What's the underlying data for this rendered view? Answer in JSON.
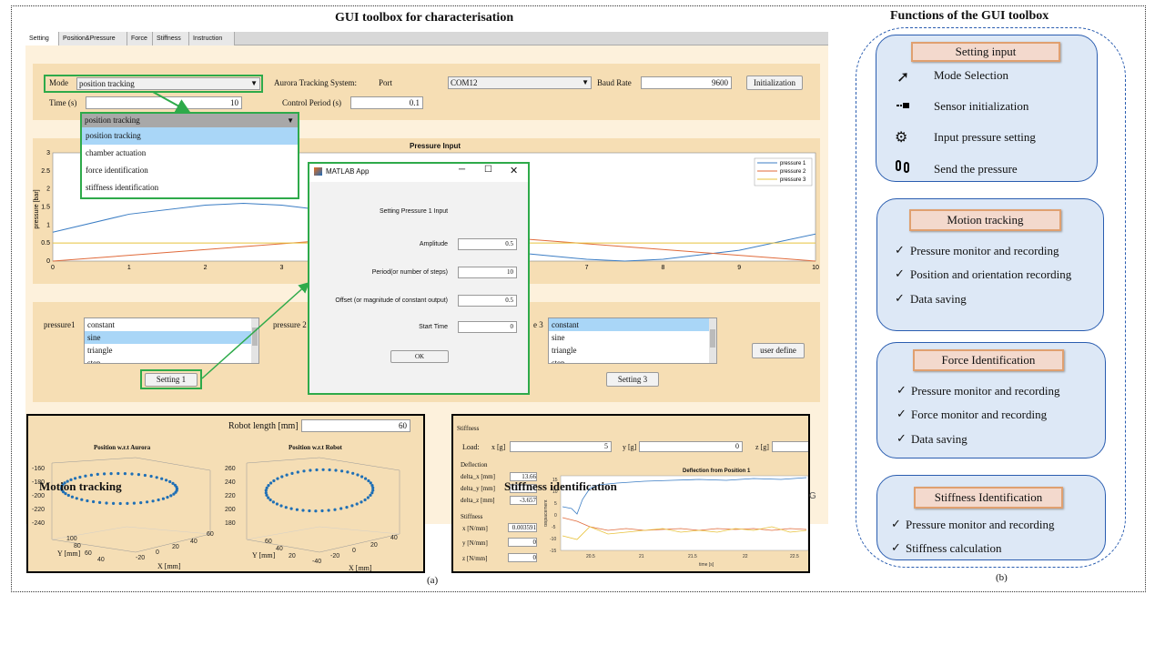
{
  "figure": {
    "left_title": "GUI toolbox for characterisation",
    "right_title": "Functions  of the GUI toolbox",
    "label_a": "(a)",
    "label_b": "(b)"
  },
  "tabs": [
    "Setting",
    "Position&Pressure",
    "Force",
    "Stiffness",
    "Instruction"
  ],
  "setting": {
    "mode_label": "Mode",
    "mode_value": "position tracking",
    "aurora_label": "Aurora Tracking System:",
    "port_label": "Port",
    "port_value": "COM12",
    "baud_label": "Baud Rate",
    "baud_value": "9600",
    "init_button": "Initialization",
    "time_label": "Time (s)",
    "time_value": "10",
    "control_label": "Control Period (s)",
    "control_value": "0.1"
  },
  "mode_dropdown": {
    "header": "position tracking",
    "options": [
      "position tracking",
      "chamber actuation",
      "force identification",
      "stiffness identification"
    ]
  },
  "pressure_chart": {
    "title": "Pressure Input",
    "ylabel": "pressure [bar]",
    "yticks": [
      "3",
      "2.5",
      "2",
      "1.5",
      "1",
      "0.5",
      "0"
    ],
    "xticks": [
      "0",
      "1",
      "2",
      "3",
      "7",
      "8",
      "9",
      "10"
    ],
    "legend": [
      "pressure 1",
      "pressure 2",
      "pressure 3"
    ],
    "colors": [
      "#3b7dc4",
      "#e06a3a",
      "#e8c23b"
    ]
  },
  "chart_data": {
    "type": "line",
    "title": "Pressure Input",
    "xlabel": "",
    "ylabel": "pressure [bar]",
    "xlim": [
      0,
      10
    ],
    "ylim": [
      0,
      3
    ],
    "series": [
      {
        "name": "pressure 1",
        "x": [
          0,
          1,
          2,
          2.5,
          3,
          4,
          5,
          6,
          7,
          7.5,
          8,
          9,
          10
        ],
        "values": [
          0.8,
          1.3,
          1.55,
          1.6,
          1.55,
          1.3,
          0.8,
          0.25,
          0.05,
          0.0,
          0.05,
          0.3,
          0.75
        ]
      },
      {
        "name": "pressure 2",
        "x": [
          0,
          5,
          10
        ],
        "values": [
          0,
          0.8,
          0
        ]
      },
      {
        "name": "pressure 3",
        "x": [
          0,
          10
        ],
        "values": [
          0.5,
          0.5
        ]
      }
    ]
  },
  "pressure_select": {
    "p1_label": "pressure1",
    "p2_label": "pressure 2",
    "p3_label": "e 3",
    "list1": [
      "constant",
      "sine",
      "triangle",
      "step"
    ],
    "list3": [
      "constant",
      "sine",
      "triangle",
      "step"
    ],
    "setting1_button": "Setting 1",
    "setting3_button": "Setting 3",
    "user_define_button": "user define"
  },
  "dialog": {
    "title": "MATLAB App",
    "heading": "Setting Pressure 1 Input",
    "amplitude_label": "Amplitude",
    "amplitude_value": "0.5",
    "period_label": "Period(or number of steps)",
    "period_value": "10",
    "offset_label": "Offset (or magnitude of constant output)",
    "offset_value": "0.5",
    "start_label": "Start Time",
    "start_value": "0",
    "ok_button": "OK"
  },
  "motion": {
    "robot_length_label": "Robot length [mm]",
    "robot_length_value": "60",
    "plot1_title": "Position w.r.t Aurora",
    "plot2_title": "Position w.r.t Robot",
    "overlay_label": "Motion tracking",
    "plot1_z_ticks": [
      "-160",
      "-180",
      "-200",
      "-220",
      "-240"
    ],
    "plot1_y_ticks": [
      "100",
      "80",
      "60",
      "40"
    ],
    "plot1_x_ticks": [
      "-20",
      "0",
      "20",
      "40",
      "60"
    ],
    "plot2_z_ticks": [
      "260",
      "240",
      "220",
      "200",
      "180"
    ],
    "plot2_y_ticks": [
      "60",
      "40",
      "20"
    ],
    "plot2_x_ticks": [
      "-40",
      "-20",
      "0",
      "20",
      "40"
    ],
    "y_axis_label": "Y [mm]",
    "x_axis_label": "X [mm]"
  },
  "stiffness": {
    "panel_label": "Stiffness",
    "load_label": "Load:",
    "x_label": "x [g]",
    "x_value": "5",
    "y_label": "y [g]",
    "y_value": "0",
    "z_label": "z [g]",
    "deflection_label": "Deflection",
    "dx_label": "delta_x [mm]",
    "dx_value": "13.66",
    "dy_label": "delta_y [mm]",
    "dz_label": "delta_z [mm]",
    "dz_value": "-3.657",
    "stiff_label": "Stiffness",
    "kx_label": "x [N/mm]",
    "kx_value": "0.003591",
    "ky_label": "y [N/mm]",
    "ky_value": "0",
    "kz_label": "z [N/mm]",
    "kz_value": "0",
    "chart_title": "Deflection from Position 1",
    "chart_ylabel": "displacement",
    "chart_xlabel": "time [s]",
    "xticks": [
      "20.5",
      "21",
      "21.5",
      "22",
      "22.5"
    ],
    "yticks": [
      "15",
      "10",
      "5",
      "0",
      "-5",
      "-10",
      "-15"
    ],
    "overlay_label": "Stiffness identification",
    "stray_char": "G"
  },
  "functions": {
    "setting": {
      "title": "Setting input",
      "items": [
        {
          "icon": "cursor-icon",
          "text": "Mode Selection"
        },
        {
          "icon": "sensor-icon",
          "text": "Sensor initialization"
        },
        {
          "icon": "gears-icon",
          "text": "Input pressure setting"
        },
        {
          "icon": "send-icon",
          "text": "Send the pressure"
        }
      ]
    },
    "motion": {
      "title": "Motion tracking",
      "items": [
        "Pressure monitor and recording",
        "Position and orientation recording",
        "Data saving"
      ]
    },
    "force": {
      "title": "Force Identification",
      "items": [
        "Pressure monitor and recording",
        "Force monitor  and recording",
        "Data saving"
      ]
    },
    "stiffness": {
      "title": "Stiffness Identification",
      "items": [
        "Pressure monitor and recording",
        "Stiffness calculation"
      ]
    },
    "check": "✓"
  }
}
